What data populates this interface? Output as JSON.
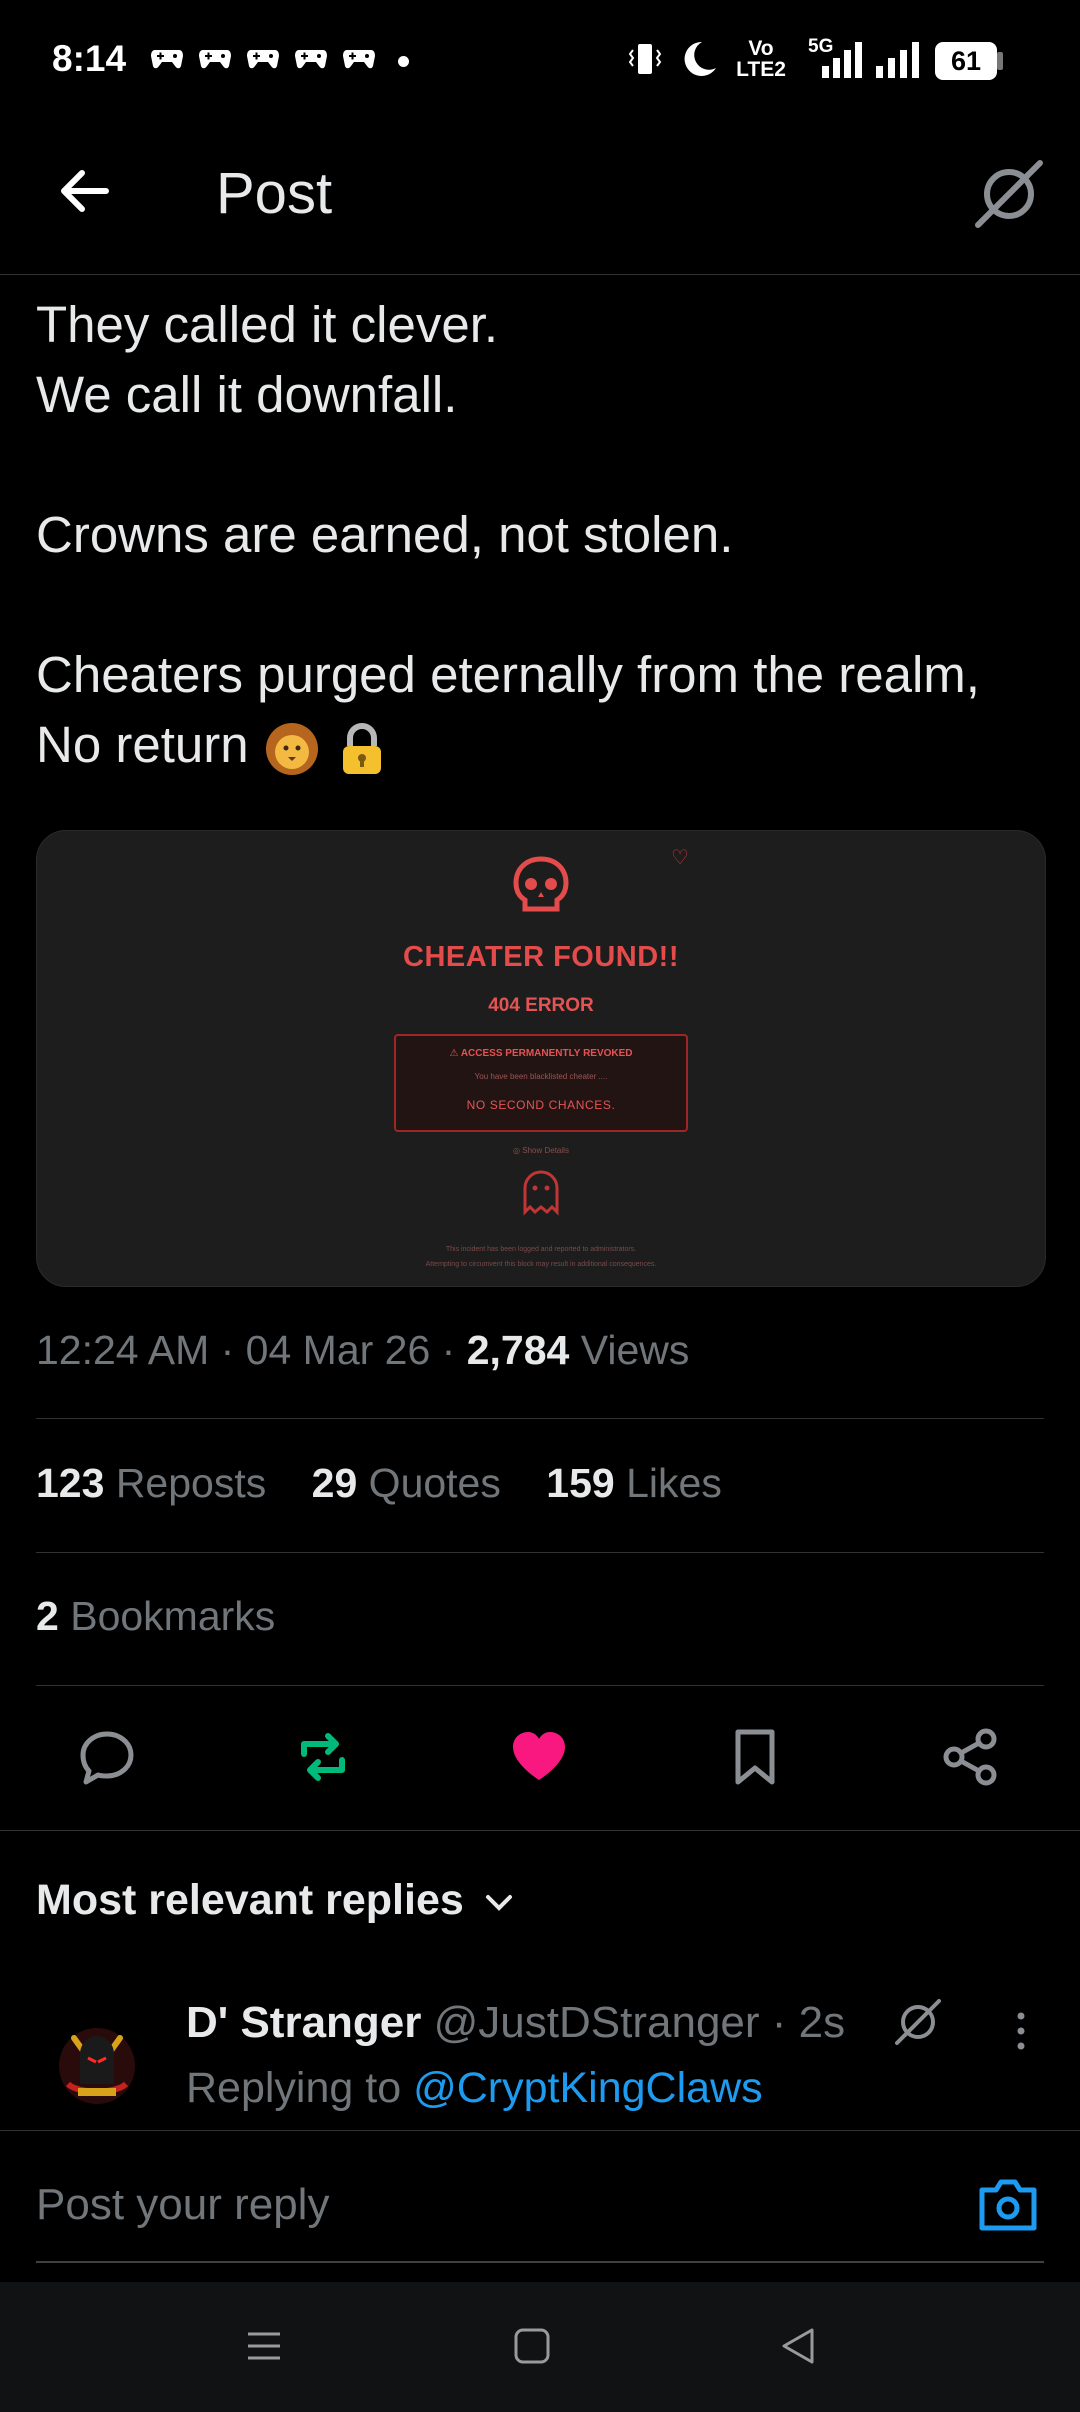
{
  "status_bar": {
    "time": "8:14",
    "battery": "61",
    "network_volte": "Vo LTE2",
    "network_5g": "5G",
    "notification_icons": [
      "game-controller-icon",
      "game-controller-icon",
      "game-controller-icon",
      "game-controller-icon",
      "game-controller-icon"
    ]
  },
  "header": {
    "title": "Post"
  },
  "post": {
    "text": "They called it clever.\nWe call it downfall.\n\nCrowns are earned, not stolen.\n\nCheaters purged eternally from the realm, No return",
    "emojis": [
      "lion-face-icon",
      "lock-icon"
    ],
    "media": {
      "title": "CHEATER FOUND!!",
      "subtitle": "404 ERROR",
      "box_line1": "ACCESS PERMANENTLY REVOKED",
      "box_line2": "You have been blacklisted cheater ....",
      "box_line3": "NO SECOND CHANCES.",
      "details": "Show Details",
      "footer1": "This incident has been logged and reported to administrators.",
      "footer2": "Attempting to circumvent this block may result in additional consequences."
    },
    "time": "12:24 AM",
    "date": "04 Mar 26",
    "views_count": "2,784",
    "views_label": "Views",
    "reposts_count": "123",
    "reposts_label": "Reposts",
    "quotes_count": "29",
    "quotes_label": "Quotes",
    "likes_count": "159",
    "likes_label": "Likes",
    "bookmarks_count": "2",
    "bookmarks_label": "Bookmarks",
    "liked": true
  },
  "colors": {
    "accent_blue": "#1d9bf0",
    "like_pink": "#f91880",
    "repost_green": "#00ba7c",
    "alert_red": "#e44b4b"
  },
  "replies": {
    "heading": "Most relevant replies",
    "items": [
      {
        "name": "D' Stranger",
        "handle": "@JustDStranger",
        "time": "2s",
        "replying_prefix": "Replying to",
        "replying_to": "@CryptKingClaws"
      }
    ]
  },
  "composer": {
    "placeholder": "Post your reply"
  }
}
